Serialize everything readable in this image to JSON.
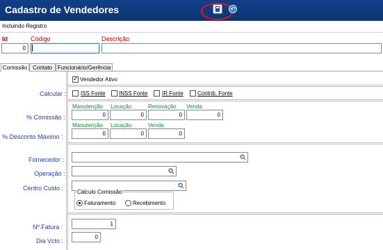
{
  "window": {
    "title": "Cadastro de Vendedores",
    "status": "Incluindo Registro"
  },
  "header": {
    "id_label": "Id",
    "id_value": "0",
    "codigo_label": "Código",
    "codigo_value": "",
    "descricao_label": "Descrição",
    "descricao_value": ""
  },
  "tabs": [
    "Comissão",
    "Contato",
    "Funcionário/Gerência"
  ],
  "comissao": {
    "vendedor_ativo": "Vendedor Ativo",
    "calcular_label": "Calcular :",
    "calcular_options": [
      "ISS Fonte",
      "INSS Fonte",
      "IR Fonte",
      "Contrib. Fonte"
    ],
    "pct_comissao_label": "% Comissão :",
    "pct_comissao_cols": [
      "Manutenção",
      "Locação",
      "Renovação",
      "Venda"
    ],
    "pct_comissao_values": [
      "0",
      "0",
      "0",
      "0"
    ],
    "pct_desconto_label": "% Desconto Máximo :",
    "pct_desconto_cols": [
      "Manutenção",
      "Locação",
      "Venda"
    ],
    "pct_desconto_values": [
      "0",
      "0",
      "0"
    ],
    "fornecedor_label": "Fornecedor :",
    "operacao_label": "Operação :",
    "centro_custo_label": "Centro Custo :",
    "calculo_comissao_label": "Cálculo Comissão",
    "calculo_options": [
      "Faturamento",
      "Recebimento"
    ],
    "calculo_selected": "Faturamento",
    "nfatura_label": "Nº.Fatura :",
    "nfatura_value": "1",
    "dia_vcto_label": "Dia Vcto :",
    "dia_vcto_value": "0"
  },
  "colors": {
    "titlebar": "#123f86",
    "label_blue": "#1a3fae",
    "label_green": "#138a2e",
    "label_red": "#d10000",
    "highlight": "#e0141b"
  }
}
